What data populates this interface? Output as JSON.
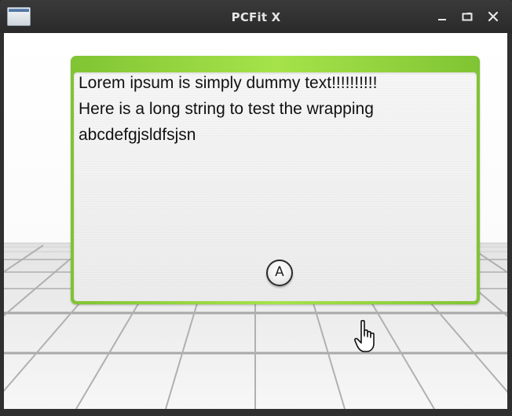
{
  "window": {
    "title": "PCFit X",
    "icons": {
      "app": "window-app-icon",
      "minimize": "minimize-icon",
      "maximize": "maximize-icon",
      "close": "close-icon"
    }
  },
  "dialog": {
    "lines": [
      "Lorem ipsum is simply dummy text!!!!!!!!!!",
      "Here is a long string to test the wrapping",
      "abcdefgjsldfsjsn"
    ],
    "confirm_button_label": "A",
    "colors": {
      "frame_green": "#8fd43a",
      "panel_background": "#f2f2f2"
    }
  },
  "cursor": {
    "icon": "hand-pointer-icon"
  }
}
